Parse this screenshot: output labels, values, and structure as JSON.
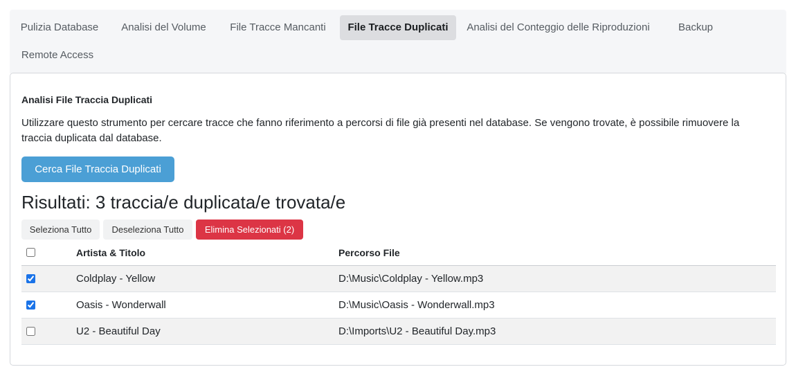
{
  "tabs": [
    {
      "label": "Pulizia Database",
      "active": false
    },
    {
      "label": "Analisi del Volume",
      "active": false
    },
    {
      "label": "File Tracce Mancanti",
      "active": false
    },
    {
      "label": "File Tracce Duplicati",
      "active": true
    },
    {
      "label": "Analisi del Conteggio delle Riproduzioni",
      "active": false
    },
    {
      "label": "Backup",
      "active": false
    },
    {
      "label": "Remote Access",
      "active": false
    }
  ],
  "panel": {
    "title": "Analisi File Traccia Duplicati",
    "description": "Utilizzare questo strumento per cercare tracce che fanno riferimento a percorsi di file già presenti nel database. Se vengono trovate, è possibile rimuovere la traccia duplicata dal database.",
    "search_button": "Cerca File Traccia Duplicati"
  },
  "results": {
    "title": "Risultati: 3 traccia/e duplicata/e trovata/e",
    "select_all": "Seleziona Tutto",
    "deselect_all": "Deseleziona Tutto",
    "delete_selected": "Elimina Selezionati (2)"
  },
  "table": {
    "columns": {
      "artist_title": "Artista & Titolo",
      "file_path": "Percorso File"
    },
    "header_checked": false,
    "rows": [
      {
        "checked": true,
        "artist_title": "Coldplay - Yellow",
        "file_path": "D:\\Music\\Coldplay - Yellow.mp3"
      },
      {
        "checked": true,
        "artist_title": "Oasis - Wonderwall",
        "file_path": "D:\\Music\\Oasis - Wonderwall.mp3"
      },
      {
        "checked": false,
        "artist_title": "U2 - Beautiful Day",
        "file_path": "D:\\Imports\\U2 - Beautiful Day.mp3"
      }
    ]
  },
  "colors": {
    "primary": "#4b9fd5",
    "danger": "#dc3545",
    "active_tab": "#dcdde0"
  }
}
